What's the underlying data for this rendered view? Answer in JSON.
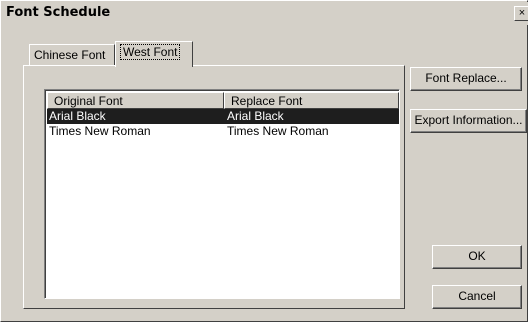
{
  "window": {
    "title": "Font Schedule",
    "close_glyph": "×"
  },
  "tabs": [
    {
      "label": "Chinese Font",
      "active": false
    },
    {
      "label": "West Font",
      "active": true
    }
  ],
  "table": {
    "columns": [
      "Original Font",
      "Replace Font"
    ],
    "rows": [
      {
        "original": "Arial Black",
        "replace": "Arial Black",
        "selected": true
      },
      {
        "original": "Times New Roman",
        "replace": "Times New Roman",
        "selected": false
      }
    ]
  },
  "buttons": {
    "font_replace": "Font Replace...",
    "export_information": "Export Information...",
    "ok": "OK",
    "cancel": "Cancel"
  },
  "colors": {
    "dialog_face": "#d4d0c8",
    "selection": "#1e1e1e"
  }
}
